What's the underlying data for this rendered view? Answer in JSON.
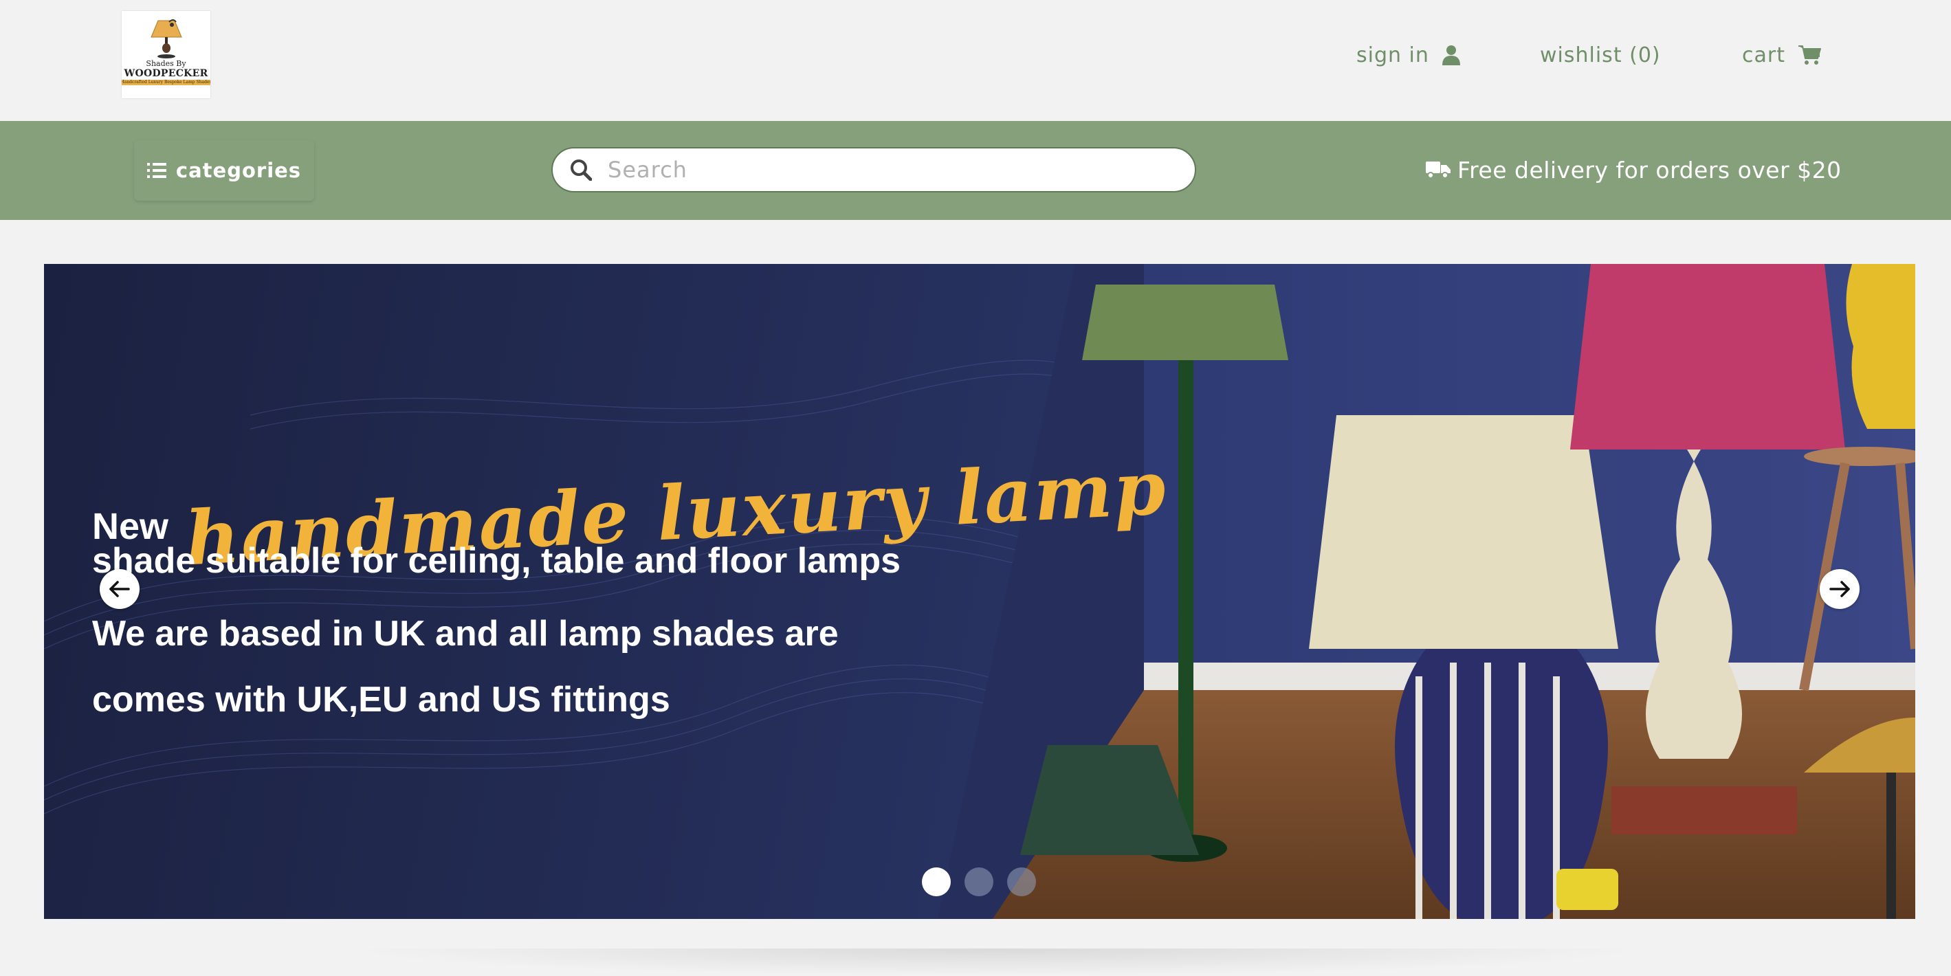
{
  "header": {
    "logo": {
      "line1": "Shades By",
      "line2": "WOODPECKER",
      "line3": "Handcrafted Luxury Bespoke Lamp Shades"
    },
    "sign_in_label": "sign in",
    "wishlist_label": "wishlist (0)",
    "cart_label": "cart"
  },
  "nav": {
    "categories_label": "categories",
    "search_placeholder": "Search",
    "search_value": "",
    "delivery_text": "Free delivery for orders over $20"
  },
  "hero": {
    "new_word": "New",
    "script_text": "handmade luxury lamp",
    "line1": "shade suitable for ceiling, table and floor lamps",
    "line2": "We are based in UK and all lamp shades are",
    "line3": "comes with UK,EU and US fittings",
    "slides_total": 3,
    "active_slide": 1
  },
  "colors": {
    "accent_green": "#86a07c",
    "link_green": "#6f8f68",
    "script_gold": "#f1b33a",
    "banner_navy": "#232c55",
    "page_bg": "#f2f2f2"
  },
  "icons": {
    "sign_in": "user-icon",
    "cart": "shopping-cart-icon",
    "categories": "list-icon",
    "search": "search-icon",
    "delivery": "truck-icon",
    "prev": "arrow-left-icon",
    "next": "arrow-right-icon"
  }
}
